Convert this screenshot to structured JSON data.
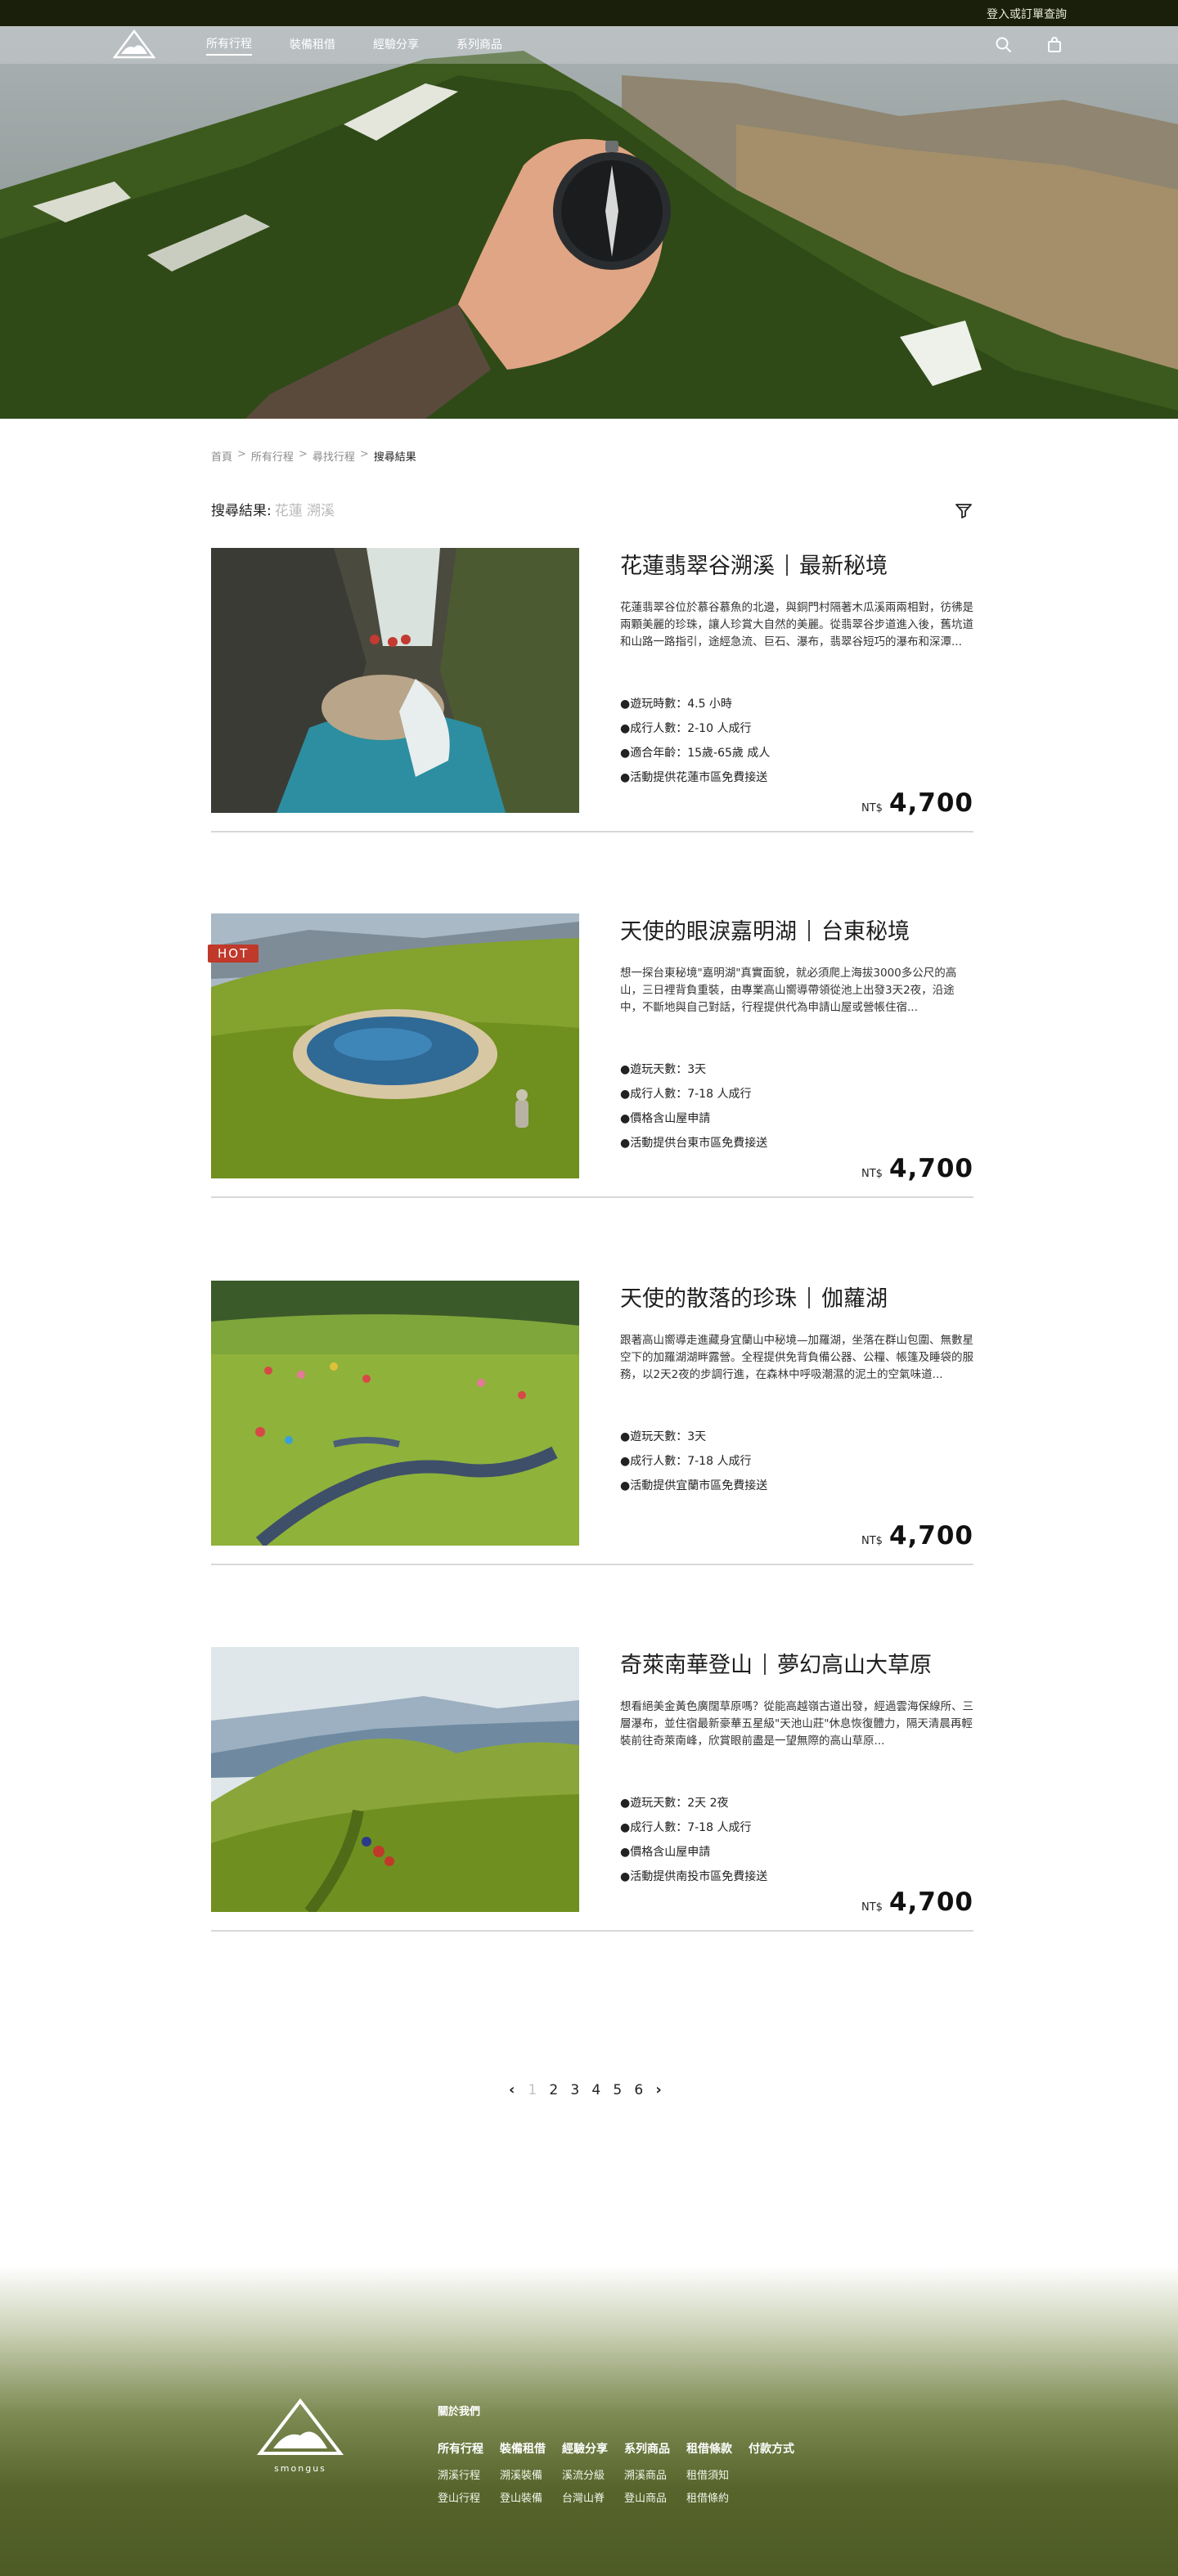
{
  "topbar": {
    "login_label": "登入或訂單查詢"
  },
  "nav": {
    "brand": "smongus",
    "links": [
      {
        "label": "所有行程",
        "active": true
      },
      {
        "label": "裝備租借",
        "active": false
      },
      {
        "label": "經驗分享",
        "active": false
      },
      {
        "label": "系列商品",
        "active": false
      }
    ],
    "search_icon": "search-icon",
    "cart_icon": "shopping-bag-icon"
  },
  "breadcrumb": {
    "items": [
      "首頁",
      "所有行程",
      "尋找行程"
    ],
    "current": "搜尋結果"
  },
  "search": {
    "label": "搜尋結果:",
    "keywords": "花蓮 溯溪",
    "filter_icon": "filter-icon"
  },
  "products": [
    {
      "title": "花蓮翡翠谷溯溪",
      "subtitle": "最新秘境",
      "hot": false,
      "description": "花蓮翡翠谷位於慕谷慕魚的北邊，與銅門村隔著木瓜溪兩兩相對，彷彿是兩顆美麗的珍珠，讓人珍賞大自然的美麗。從翡翠谷步道進入後，舊坑道和山路一路指引，途經急流、巨石、瀑布，翡翠谷短巧的瀑布和深潭...",
      "features": [
        "●遊玩時數：4.5 小時",
        "●成行人數：2-10 人成行",
        "●適合年齡：15歲-65歲 成人",
        "●活動提供花蓮市區免費接送"
      ],
      "currency": "NT$",
      "price": "4,700"
    },
    {
      "title": "天使的眼淚嘉明湖",
      "subtitle": "台東秘境",
      "hot": true,
      "hot_label": "HOT",
      "description": "想一探台東秘境\"嘉明湖\"真實面貌，就必須爬上海拔3000多公尺的高山，三日裡背負重裝，由專業高山嚮導帶領從池上出發3天2夜，沿途中，不斷地與自己對話，行程提供代為申請山屋或營帳住宿...",
      "features": [
        "●遊玩天數：3天",
        "●成行人數：7-18 人成行",
        "●價格含山屋申請",
        "●活動提供台東市區免費接送"
      ],
      "currency": "NT$",
      "price": "4,700"
    },
    {
      "title": "天使的散落的珍珠",
      "subtitle": "伽蘿湖",
      "hot": false,
      "description": "跟著高山嚮導走進藏身宜蘭山中秘境—加羅湖，坐落在群山包圍、無數星空下的加羅湖湖畔露營。全程提供免背負備公器、公糧、帳篷及睡袋的服務，以2天2夜的步調行進，在森林中呼吸潮濕的泥土的空氣味道...",
      "features": [
        "●遊玩天數：3天",
        "●成行人數：7-18 人成行",
        "●活動提供宜蘭市區免費接送"
      ],
      "currency": "NT$",
      "price": "4,700"
    },
    {
      "title": "奇萊南華登山",
      "subtitle": "夢幻高山大草原",
      "hot": false,
      "description": "想看絕美金黃色廣闊草原嗎？從能高越嶺古道出發，經過雲海保線所、三層瀑布，並住宿最新豪華五星級\"天池山莊\"休息恢復體力，隔天清晨再輕裝前往奇萊南峰，欣賞眼前盡是一望無際的高山草原...",
      "features": [
        "●遊玩天數：2天 2夜",
        "●成行人數：7-18 人成行",
        "●價格含山屋申請",
        "●活動提供南投市區免費接送"
      ],
      "currency": "NT$",
      "price": "4,700"
    }
  ],
  "pagination": {
    "prev_icon": "chevron-left-icon",
    "next_icon": "chevron-right-icon",
    "pages": [
      "1",
      "2",
      "3",
      "4",
      "5",
      "6"
    ],
    "current": "1"
  },
  "footer": {
    "brand": "smongus",
    "about": "關於我們",
    "columns": [
      {
        "head": "所有行程",
        "links": [
          "溯溪行程",
          "登山行程"
        ]
      },
      {
        "head": "裝備租借",
        "links": [
          "溯溪裝備",
          "登山裝備"
        ]
      },
      {
        "head": "經驗分享",
        "links": [
          "溪流分級",
          "台灣山脊"
        ]
      },
      {
        "head": "系列商品",
        "links": [
          "溯溪商品",
          "登山商品"
        ]
      },
      {
        "head": "租借條款",
        "links": [
          "租借須知",
          "租借條約"
        ]
      },
      {
        "head": "付款方式",
        "links": []
      }
    ]
  },
  "colors": {
    "topbar": "#1a1f0c",
    "hot_badge": "#c0392b",
    "footer_green": "#4d5a24"
  }
}
